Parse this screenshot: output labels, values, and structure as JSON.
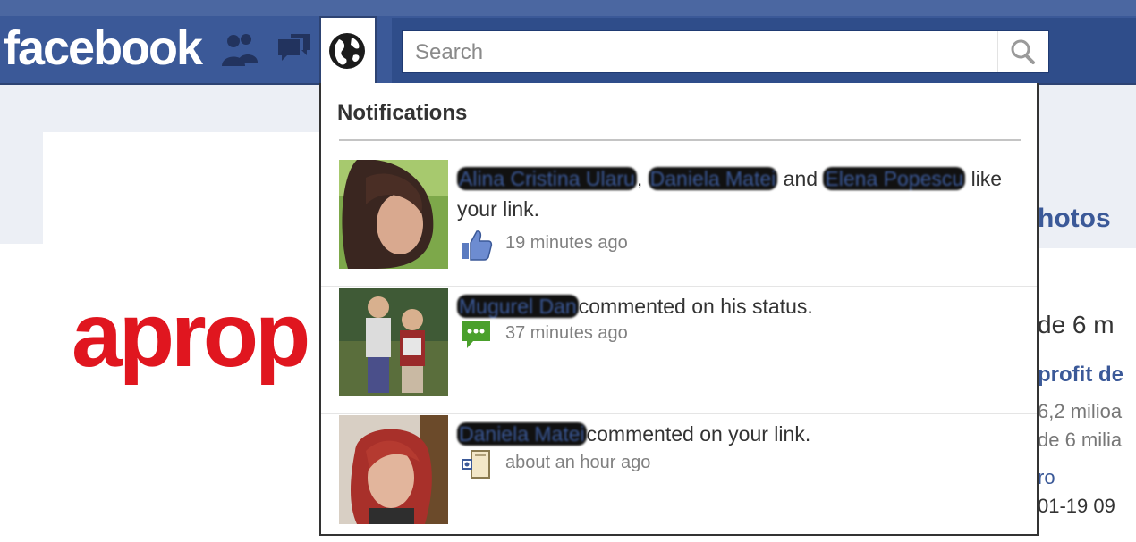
{
  "topbar": {
    "logo": "facebook",
    "search_placeholder": "Search"
  },
  "background": {
    "brand_logo": "aprop",
    "right_fragments": [
      "hotos",
      "de 6 m",
      "profit de",
      "6,2 milioa",
      "de 6 milia",
      "ro",
      "01-19 09"
    ]
  },
  "notifications": {
    "title": "Notifications",
    "items": [
      {
        "names": [
          "Alina Cristina Ularu",
          "Daniela Matei",
          "Elena Popescu"
        ],
        "sep1": ",",
        "and": "and",
        "text": "like your link.",
        "time": "19 minutes ago",
        "icon": "like-icon"
      },
      {
        "names": [
          "Mugurel Dan"
        ],
        "text": "commented on his status.",
        "time": "37 minutes ago",
        "icon": "comment-icon"
      },
      {
        "names": [
          "Daniela Matei"
        ],
        "text": "commented on your link.",
        "time": "about an hour ago",
        "icon": "link-comment-icon"
      }
    ]
  },
  "colors": {
    "brand_blue": "#3b5998",
    "aprop_red": "#e0161f",
    "comment_green": "#4aa02c"
  }
}
